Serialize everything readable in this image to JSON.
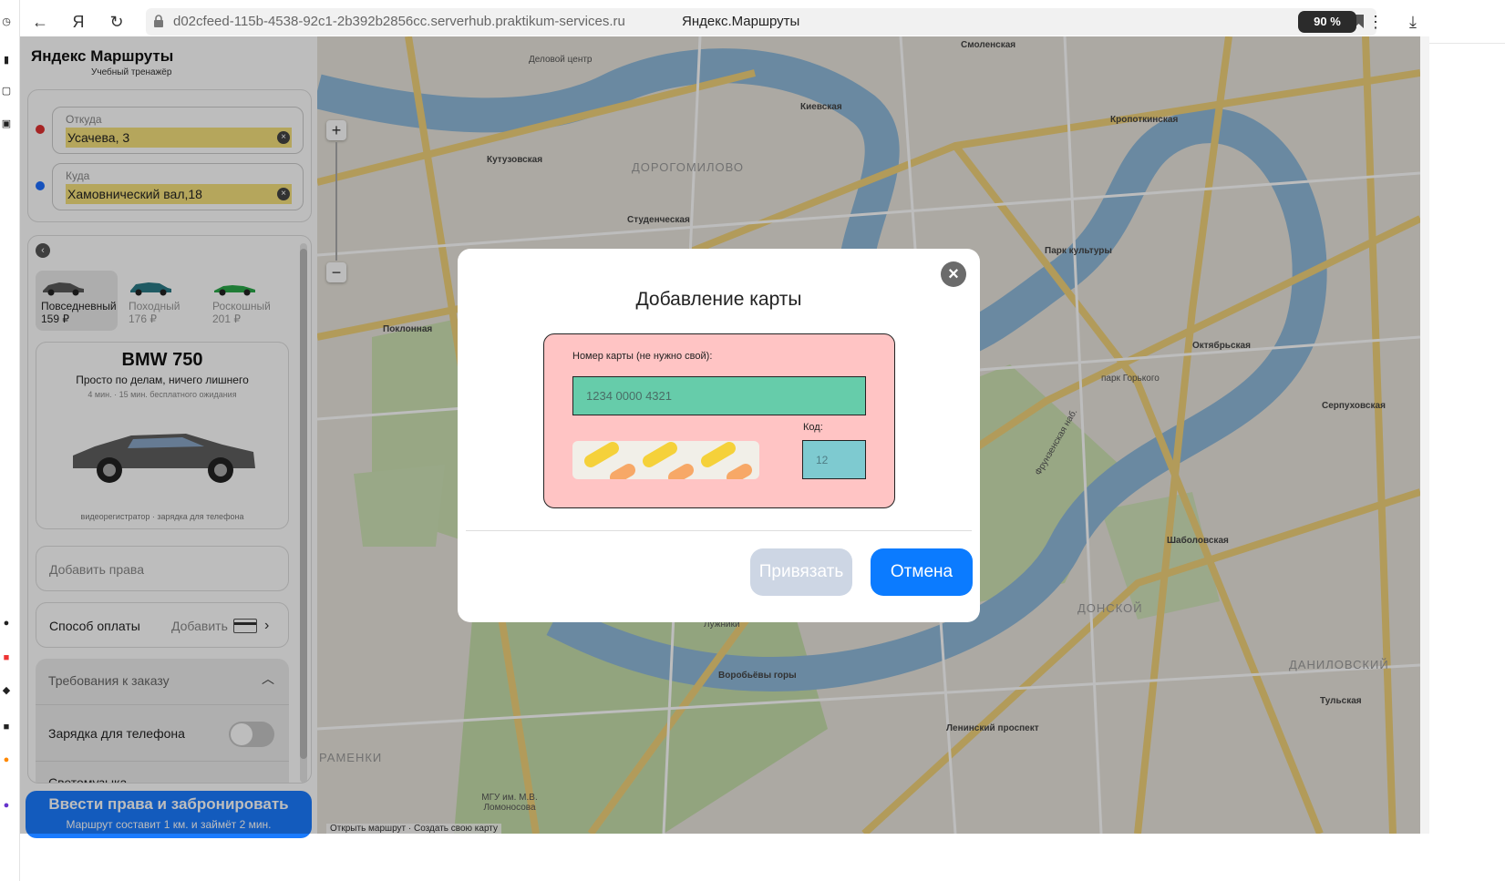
{
  "browser": {
    "url": "d02cfeed-115b-4538-92c1-2b392b2856cc.serverhub.praktikum-services.ru",
    "tab_title": "Яндекс.Маршруты",
    "zoom": "90 %"
  },
  "sidebar": {
    "brand": "Яндекс Маршруты",
    "brand_sub": "Учебный тренажёр",
    "from": {
      "label": "Откуда",
      "value": "Усачева, 3",
      "dot_color": "#e03131"
    },
    "to": {
      "label": "Куда",
      "value": "Хамовнический вал,18",
      "dot_color": "#1e6fff"
    },
    "tariffs": [
      {
        "name": "Повседневный",
        "price": "159 ₽",
        "color": "#5a5a5a",
        "active": true
      },
      {
        "name": "Походный",
        "price": "176 ₽",
        "color": "#2b7a86",
        "active": false
      },
      {
        "name": "Роскошный",
        "price": "201 ₽",
        "color": "#2aa84a",
        "active": false
      }
    ],
    "car": {
      "model": "BMW 750",
      "description": "Просто по делам, ничего лишнего",
      "note": "4 мин. · 15 мин. бесплатного ожидания",
      "features": "видеорегистратор · зарядка для телефона"
    },
    "license_placeholder": "Добавить права",
    "payment": {
      "label": "Способ оплаты",
      "action": "Добавить"
    },
    "requirements": {
      "title": "Требования к заказу",
      "items": [
        "Зарядка для телефона",
        "Светомузыка"
      ]
    },
    "book_button": {
      "title": "Ввести права и забронировать",
      "subtitle": "Маршрут составит 1 км. и займёт 2 мин."
    }
  },
  "map": {
    "labels": {
      "dorogomilovo": "ДОРОГОМИЛОВО",
      "donskoy": "ДОНСКОЙ",
      "danilovsky": "ДАНИЛОВСКИЙ",
      "ramenki": "РАМЕНКИ",
      "kutuzovskaya": "Кутузовская",
      "kievskaya": "Киевская",
      "studencheskaya": "Студенческая",
      "park_kultury": "Парк культуры",
      "oktyabrskaya": "Октябрьская",
      "shabolovskaya": "Шаболовская",
      "leninsky": "Ленинский проспект",
      "vorobyovy": "Воробьёвы горы",
      "luzhniki": "Лужники",
      "poklonnaya": "Поклонная",
      "park_gorkogo": "парк Горького",
      "frunzenskaya": "Фрунзенская наб.",
      "kropotkinskaya": "Кропоткинская",
      "smolenskaya": "Смоленская",
      "delovoy": "Деловой центр",
      "moscow_university": "МГУ им. М.В. Ломоносова",
      "tulskaya": "Тульская",
      "serpukhovskaya": "Серпуховская"
    },
    "bottom_links": "Открыть маршрут · Создать свою карту"
  },
  "modal": {
    "title": "Добавление карты",
    "number_label": "Номер карты (не нужно свой):",
    "number_placeholder": "1234 0000 4321",
    "code_label": "Код:",
    "code_placeholder": "12",
    "bind_button": "Привязать",
    "cancel_button": "Отмена"
  }
}
